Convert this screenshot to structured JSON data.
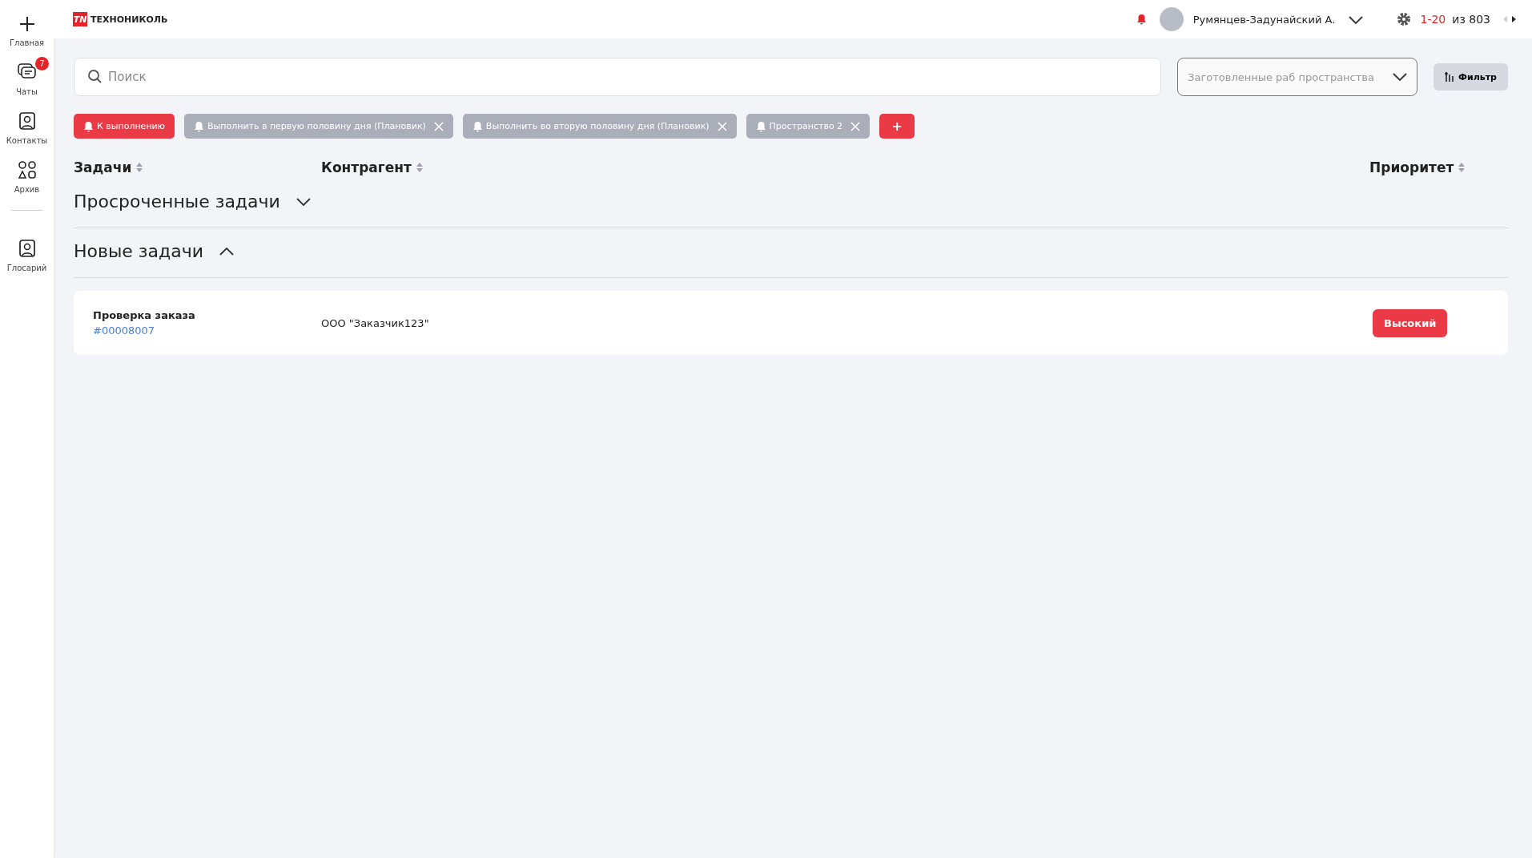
{
  "sidebar": {
    "items": [
      {
        "kind": "plus",
        "label": "Главная"
      },
      {
        "kind": "chat",
        "label": "Чаты",
        "badge": "7"
      },
      {
        "kind": "contact",
        "label": "Контакты"
      },
      {
        "kind": "shapes",
        "label": "Архив"
      },
      {
        "kind": "divider"
      },
      {
        "kind": "contact",
        "label": "Глосарий"
      }
    ]
  },
  "header": {
    "logo_mark": "TN",
    "logo_text": "ТЕХНОНИКОЛЬ",
    "user_name": "Румянцев-Задунайский А.",
    "pager_range": "1-20",
    "pager_total": "из 803"
  },
  "search": {
    "placeholder": "Поиск"
  },
  "workspace_select": {
    "placeholder": "Заготовленные раб пространства"
  },
  "filter_button": "Фильтр",
  "chips": [
    {
      "label": "К выполнению",
      "selected": true,
      "removable": false
    },
    {
      "label": "Выполнить в первую половину дня (Плановик)",
      "selected": false,
      "removable": true
    },
    {
      "label": "Выполнить во вторую половину дня (Плановик)",
      "selected": false,
      "removable": true
    },
    {
      "label": "Пространство 2",
      "selected": false,
      "removable": true
    }
  ],
  "add_chip": "+",
  "columns": [
    "Задачи",
    "Контрагент",
    "Приоритет"
  ],
  "groups": [
    {
      "title": "Просроченные задачи",
      "expanded": false
    },
    {
      "title": "Новые задачи",
      "expanded": true,
      "rows": [
        {
          "task": "Проверка заказа",
          "number": "#00008007",
          "counterparty": "ООО \"Заказчик123\"",
          "priority": "Высокий"
        }
      ]
    }
  ]
}
